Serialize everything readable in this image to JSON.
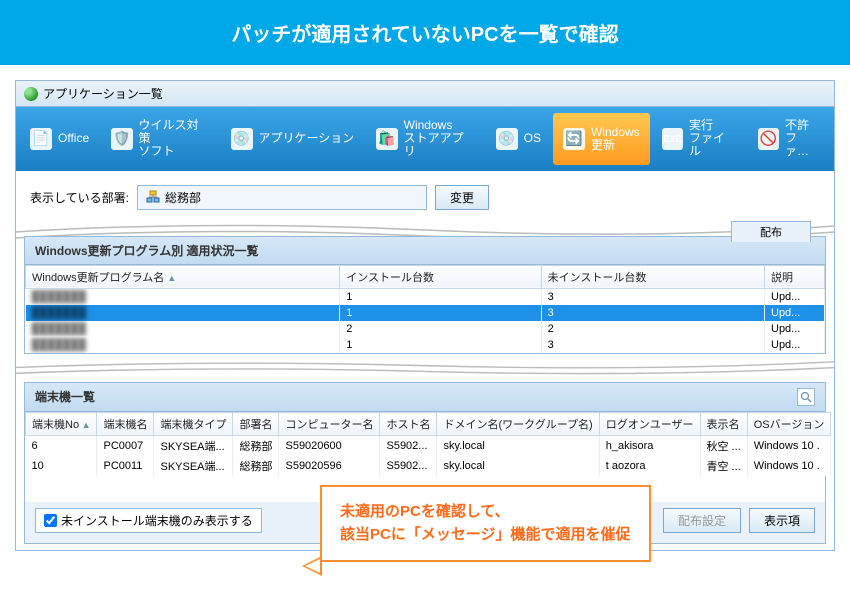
{
  "banner": "パッチが適用されていないPCを一覧で確認",
  "titlebar": "アプリケーション一覧",
  "toolbar": {
    "office": "Office",
    "antivirus": "ウイルス対策\nソフト",
    "application": "アプリケーション",
    "winstore": "Windows\nストアアプリ",
    "os": "OS",
    "winupdate": "Windows\n更新",
    "exec": "実行\nファイル",
    "blocked": "不許\nファ…"
  },
  "filter": {
    "label": "表示している部署:",
    "value": "総務部",
    "change_btn": "変更"
  },
  "dist_tab": "配布",
  "update_section": {
    "title": "Windows更新プログラム別 適用状況一覧",
    "cols": [
      "Windows更新プログラム名",
      "インストール台数",
      "未インストール台数",
      "説明"
    ],
    "rows": [
      {
        "name": "███████",
        "inst": "1",
        "notinst": "3",
        "desc": "Upd..."
      },
      {
        "name": "███████",
        "inst": "1",
        "notinst": "3",
        "desc": "Upd...",
        "sel": true
      },
      {
        "name": "███████",
        "inst": "2",
        "notinst": "2",
        "desc": "Upd..."
      },
      {
        "name": "███████",
        "inst": "1",
        "notinst": "3",
        "desc": "Upd..."
      }
    ]
  },
  "terminal_section": {
    "title": "端末機一覧",
    "cols": [
      "端末機No",
      "端末機名",
      "端末機タイプ",
      "部署名",
      "コンピューター名",
      "ホスト名",
      "ドメイン名(ワークグループ名)",
      "ログオンユーザー",
      "表示名",
      "OSバージョン"
    ],
    "rows": [
      {
        "no": "6",
        "name": "PC0007",
        "type": "SKYSEA端...",
        "dept": "総務部",
        "comp": "S59020600",
        "host": "S5902...",
        "domain": "sky.local",
        "user": "h_akisora",
        "disp": "秋空 ...",
        "os": "Windows 10 ."
      },
      {
        "no": "10",
        "name": "PC0011",
        "type": "SKYSEA端...",
        "dept": "総務部",
        "comp": "S59020596",
        "host": "S5902...",
        "domain": "sky.local",
        "user": "t aozora",
        "disp": "青空 ...",
        "os": "Windows 10 ."
      }
    ]
  },
  "bottom": {
    "checkbox": "未インストール端末機のみ表示する",
    "dist_settings": "配布設定",
    "disp_btn": "表示項"
  },
  "callout": {
    "line1": "未適用のPCを確認して、",
    "line2": "該当PCに「メッセージ」機能で適用を催促"
  }
}
